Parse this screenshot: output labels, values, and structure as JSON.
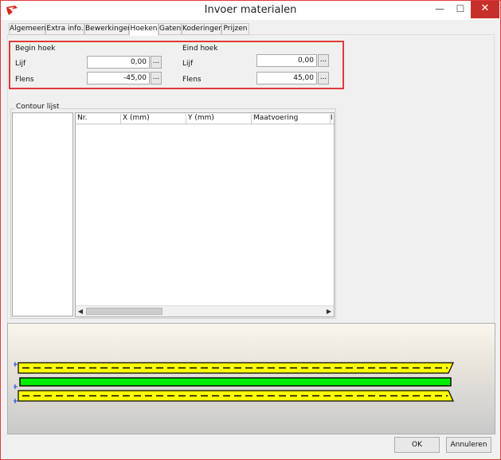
{
  "window": {
    "title": "Invoer materialen",
    "controls": {
      "minimize": "—",
      "maximize": "☐",
      "close": "✕"
    }
  },
  "tabs": [
    {
      "label": "Algemeen",
      "active": false
    },
    {
      "label": "Extra info.",
      "active": false
    },
    {
      "label": "Bewerkingen",
      "active": false
    },
    {
      "label": "Hoeken",
      "active": true
    },
    {
      "label": "Gaten",
      "active": false
    },
    {
      "label": "Koderingen",
      "active": false
    },
    {
      "label": "Prijzen",
      "active": false
    }
  ],
  "begin_hoek": {
    "title": "Begin hoek",
    "lijf_label": "Lijf",
    "lijf_value": "0,00",
    "flens_label": "Flens",
    "flens_value": "-45,00"
  },
  "eind_hoek": {
    "title": "Eind hoek",
    "lijf_label": "Lijf",
    "lijf_value": "0,00",
    "flens_label": "Flens",
    "flens_value": "45,00"
  },
  "ellipsis": "...",
  "contour": {
    "title": "Contour lijst",
    "columns": [
      "Nr.",
      "X (mm)",
      "Y (mm)",
      "Maatvoering",
      "I"
    ]
  },
  "colors": {
    "accent": "#e03a3a",
    "beam_yellow": "#ffff00",
    "beam_green": "#00ee00",
    "dim_blue": "#1f3fd0"
  },
  "buttons": {
    "ok": "OK",
    "cancel": "Annuleren"
  }
}
